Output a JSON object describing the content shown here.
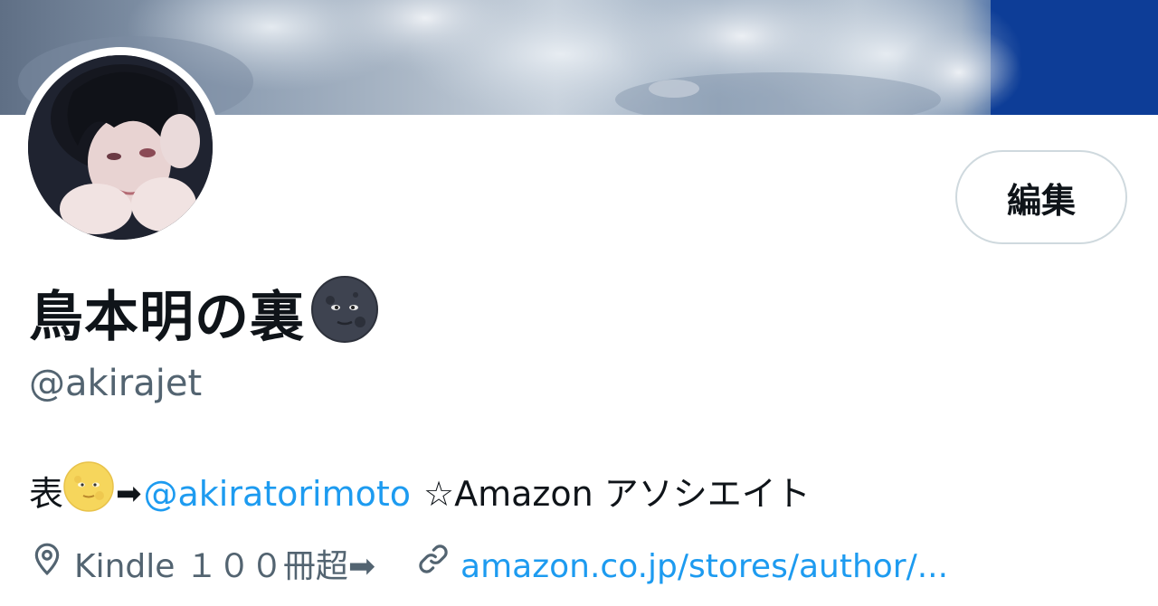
{
  "profile": {
    "display_name": "鳥本明の裏",
    "name_emoji": "new-moon-face-emoji",
    "handle": "@akirajet",
    "edit_label": "編集",
    "bio": {
      "prefix": "表",
      "emoji_1": "full-moon-face-emoji",
      "arrow": "➡",
      "mention": "@akiratorimoto",
      "suffix": "☆Amazon アソシエイト"
    },
    "location": "Kindle １００冊超➡",
    "website": "amazon.co.jp/stores/author/..."
  },
  "colors": {
    "accent": "#1d9bf0",
    "secondary_text": "#536471",
    "primary_text": "#0f1419",
    "button_border": "#cfd9de",
    "banner_sky": "#0f3f99"
  }
}
